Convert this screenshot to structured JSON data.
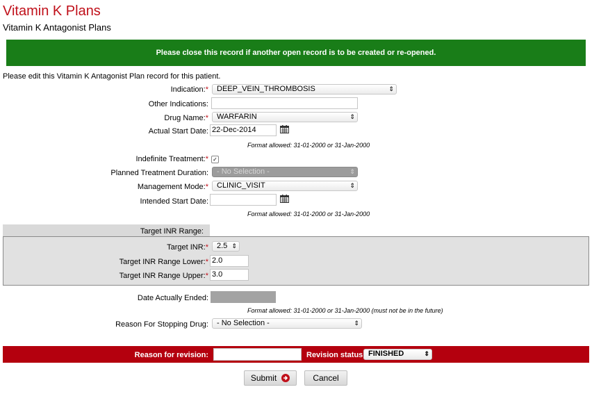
{
  "header": {
    "title": "Vitamin K Plans",
    "subtitle": "Vitamin K Antagonist Plans"
  },
  "banner": {
    "text": "Please close this record if another open record is to be created or re-opened."
  },
  "intro": "Please edit this Vitamin K Antagonist Plan record for this patient.",
  "required_marker": "*",
  "fields": {
    "indication": {
      "label": "Indication:",
      "value": "DEEP_VEIN_THROMBOSIS"
    },
    "other_indications": {
      "label": "Other Indications:",
      "value": ""
    },
    "drug_name": {
      "label": "Drug Name:",
      "value": "WARFARIN"
    },
    "actual_start_date": {
      "label": "Actual Start Date:",
      "value": "22-Dec-2014"
    },
    "format_hint": "Format allowed: 31-01-2000 or 31-Jan-2000",
    "indefinite_treatment": {
      "label": "Indefinite Treatment:",
      "checked": true,
      "check_glyph": "✓"
    },
    "planned_duration": {
      "label": "Planned Treatment Duration:",
      "value": "- No Selection -"
    },
    "management_mode": {
      "label": "Management Mode:",
      "value": "CLINIC_VISIT"
    },
    "intended_start_date": {
      "label": "Intended Start Date:",
      "value": ""
    },
    "target_inr_range": {
      "label": "Target INR Range:"
    },
    "target_inr": {
      "label": "Target INR:",
      "value": "2.5"
    },
    "target_inr_lower": {
      "label": "Target INR Range Lower:",
      "value": "2.0"
    },
    "target_inr_upper": {
      "label": "Target INR Range Upper:",
      "value": "3.0"
    },
    "date_actually_ended": {
      "label": "Date Actually Ended:",
      "value": ""
    },
    "format_hint_future": "Format allowed: 31-01-2000 or 31-Jan-2000 (must not be in the future)",
    "reason_stopping": {
      "label": "Reason For Stopping Drug:",
      "value": "- No Selection -"
    }
  },
  "revision": {
    "reason_label": "Reason for revision:",
    "reason_value": "",
    "status_label": "Revision status:",
    "status_value": "FINISHED"
  },
  "buttons": {
    "submit": "Submit",
    "cancel": "Cancel"
  },
  "icons": {
    "select_arrow": "⇕",
    "calendar": "calendar-icon",
    "submit_arrow": "arrow-right-circle-icon"
  },
  "colors": {
    "title": "#c0101a",
    "banner": "#197d18",
    "revision_bar": "#b4000e"
  }
}
